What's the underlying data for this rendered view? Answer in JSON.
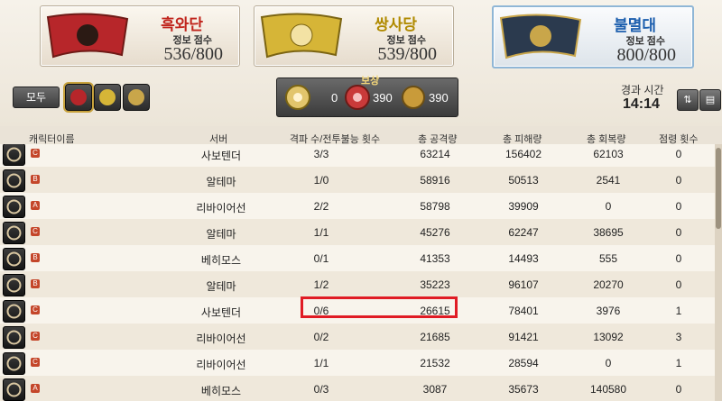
{
  "teams": [
    {
      "name": "흑와단",
      "info_label": "정보 점수",
      "score": "536/800",
      "color": "#c0241c"
    },
    {
      "name": "쌍사당",
      "info_label": "정보 점수",
      "score": "539/800",
      "color": "#b08a00"
    },
    {
      "name": "불멸대",
      "info_label": "정보 점수",
      "score": "800/800",
      "color": "#1d5fae"
    }
  ],
  "filters": {
    "all_label": "모두"
  },
  "reward": {
    "label": "보상",
    "values": [
      "0",
      "390",
      "390"
    ]
  },
  "elapsed": {
    "label": "경과 시간",
    "time": "14:14"
  },
  "columns": [
    "캐릭터이름",
    "서버",
    "격파 수/전투불능 횟수",
    "총 공격량",
    "총 피해량",
    "총 회복량",
    "점령 횟수"
  ],
  "rows": [
    {
      "server": "사보텐더",
      "kd": "3/3",
      "atk": "63214",
      "dmg": "156402",
      "heal": "62103",
      "cap": "0",
      "rank": "C"
    },
    {
      "server": "알테마",
      "kd": "1/0",
      "atk": "58916",
      "dmg": "50513",
      "heal": "2541",
      "cap": "0",
      "rank": "B"
    },
    {
      "server": "리바이어선",
      "kd": "2/2",
      "atk": "58798",
      "dmg": "39909",
      "heal": "0",
      "cap": "0",
      "rank": "A"
    },
    {
      "server": "알테마",
      "kd": "1/1",
      "atk": "45276",
      "dmg": "62247",
      "heal": "38695",
      "cap": "0",
      "rank": "C"
    },
    {
      "server": "베히모스",
      "kd": "0/1",
      "atk": "41353",
      "dmg": "14493",
      "heal": "555",
      "cap": "0",
      "rank": "B"
    },
    {
      "server": "알테마",
      "kd": "1/2",
      "atk": "35223",
      "dmg": "96107",
      "heal": "20270",
      "cap": "0",
      "rank": "B"
    },
    {
      "server": "사보텐더",
      "kd": "0/6",
      "atk": "26615",
      "dmg": "78401",
      "heal": "3976",
      "cap": "1",
      "rank": "C"
    },
    {
      "server": "리바이어선",
      "kd": "0/2",
      "atk": "21685",
      "dmg": "91421",
      "heal": "13092",
      "cap": "3",
      "rank": "C"
    },
    {
      "server": "리바이어선",
      "kd": "1/1",
      "atk": "21532",
      "dmg": "28594",
      "heal": "0",
      "cap": "1",
      "rank": "C"
    },
    {
      "server": "베히모스",
      "kd": "0/3",
      "atk": "3087",
      "dmg": "35673",
      "heal": "140580",
      "cap": "0",
      "rank": "A"
    }
  ],
  "icons": {
    "sort": "sort-icon",
    "copy": "copy-icon"
  }
}
